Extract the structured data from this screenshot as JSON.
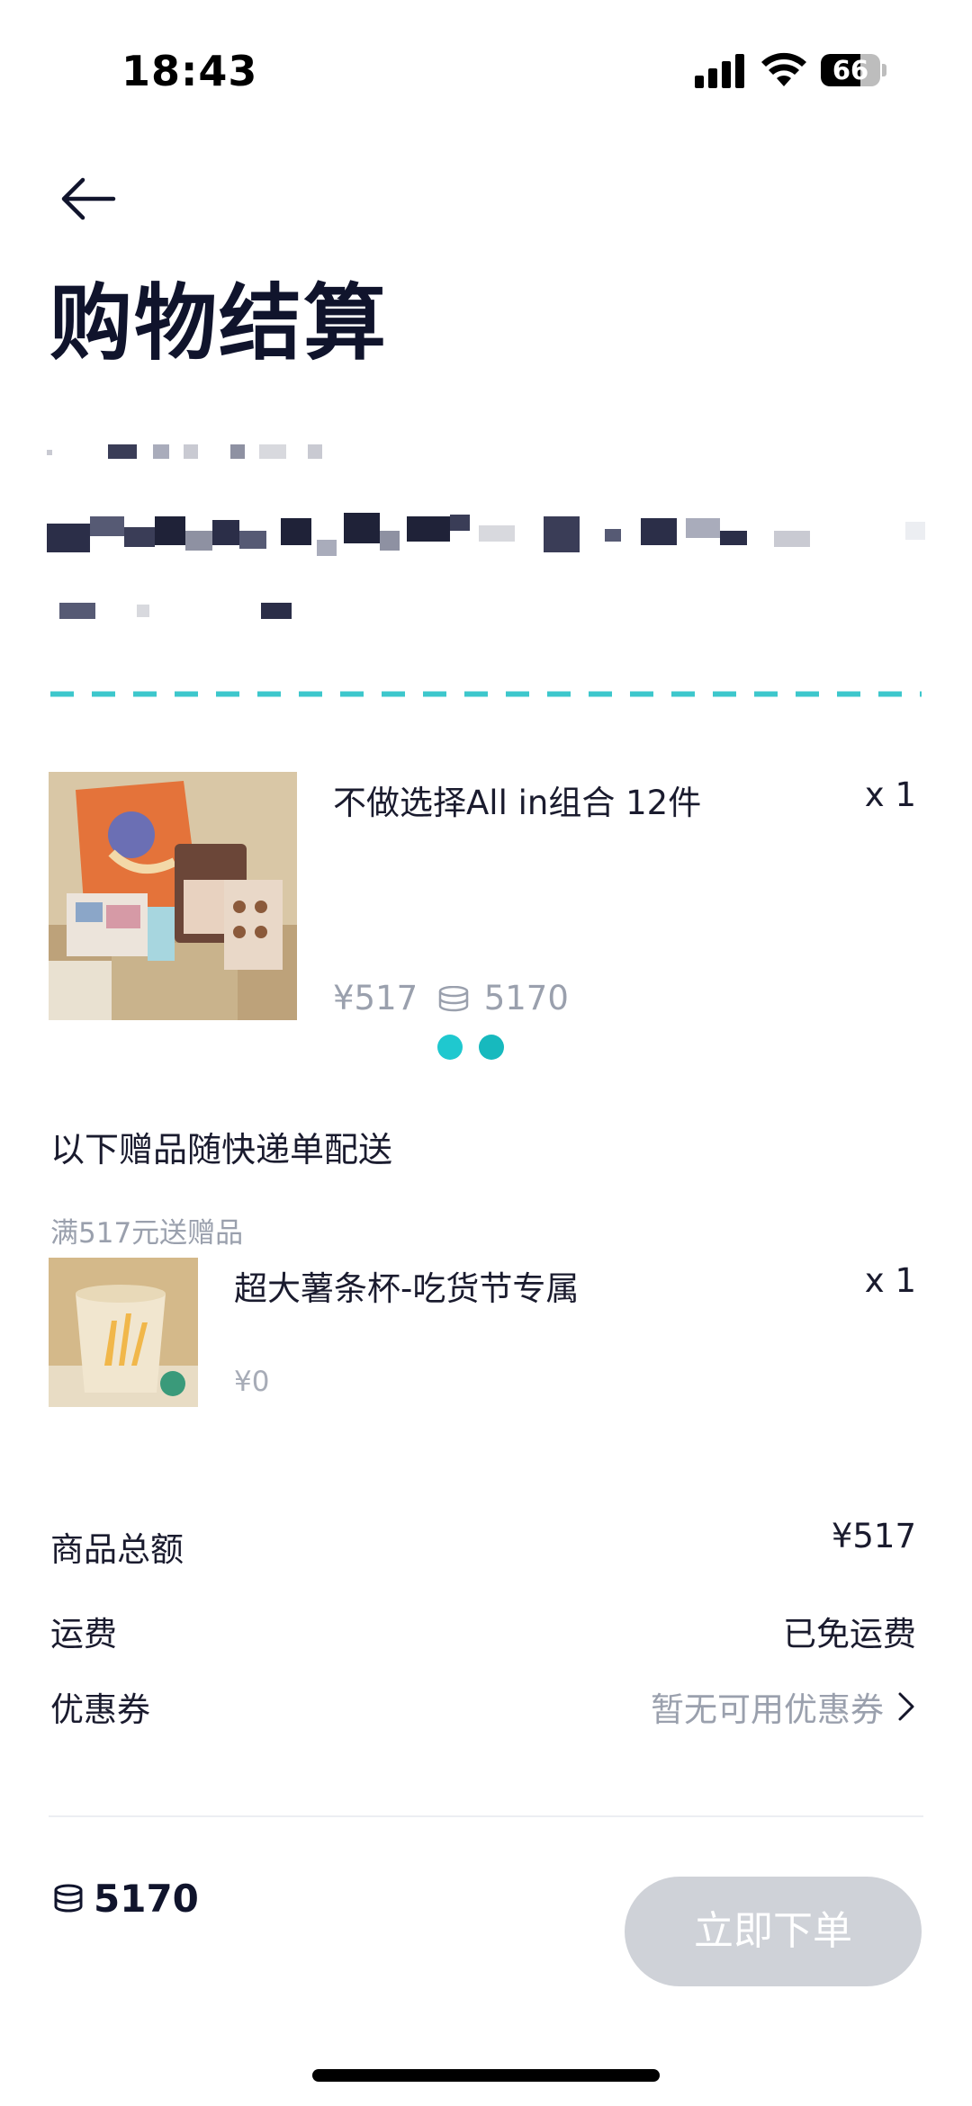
{
  "status_bar": {
    "time": "18:43",
    "battery": "66",
    "battery_level": 0.66
  },
  "header": {
    "title": "购物结算",
    "back_icon": "arrow-left-icon"
  },
  "product": {
    "name": "不做选择All in组合 12件",
    "quantity": "x 1",
    "price": "¥517",
    "coin_price": "5170",
    "carousel_pages": 2
  },
  "gifts": {
    "heading": "以下赠品随快递单配送",
    "condition": "满517元送赠品",
    "item": {
      "name": "超大薯条杯-吃货节专属",
      "quantity": "x 1",
      "price": "¥0"
    }
  },
  "summary": {
    "subtotal_label": "商品总额",
    "subtotal_value": "¥517",
    "shipping_label": "运费",
    "shipping_value": "已免运费",
    "coupon_label": "优惠券",
    "coupon_value": "暂无可用优惠券"
  },
  "footer": {
    "total_coins": "5170",
    "order_button": "立即下单"
  },
  "colors": {
    "accent": "#1fc8cf",
    "title": "#10142c",
    "muted": "#9aa0ad",
    "button_disabled": "#cfd2d8"
  }
}
